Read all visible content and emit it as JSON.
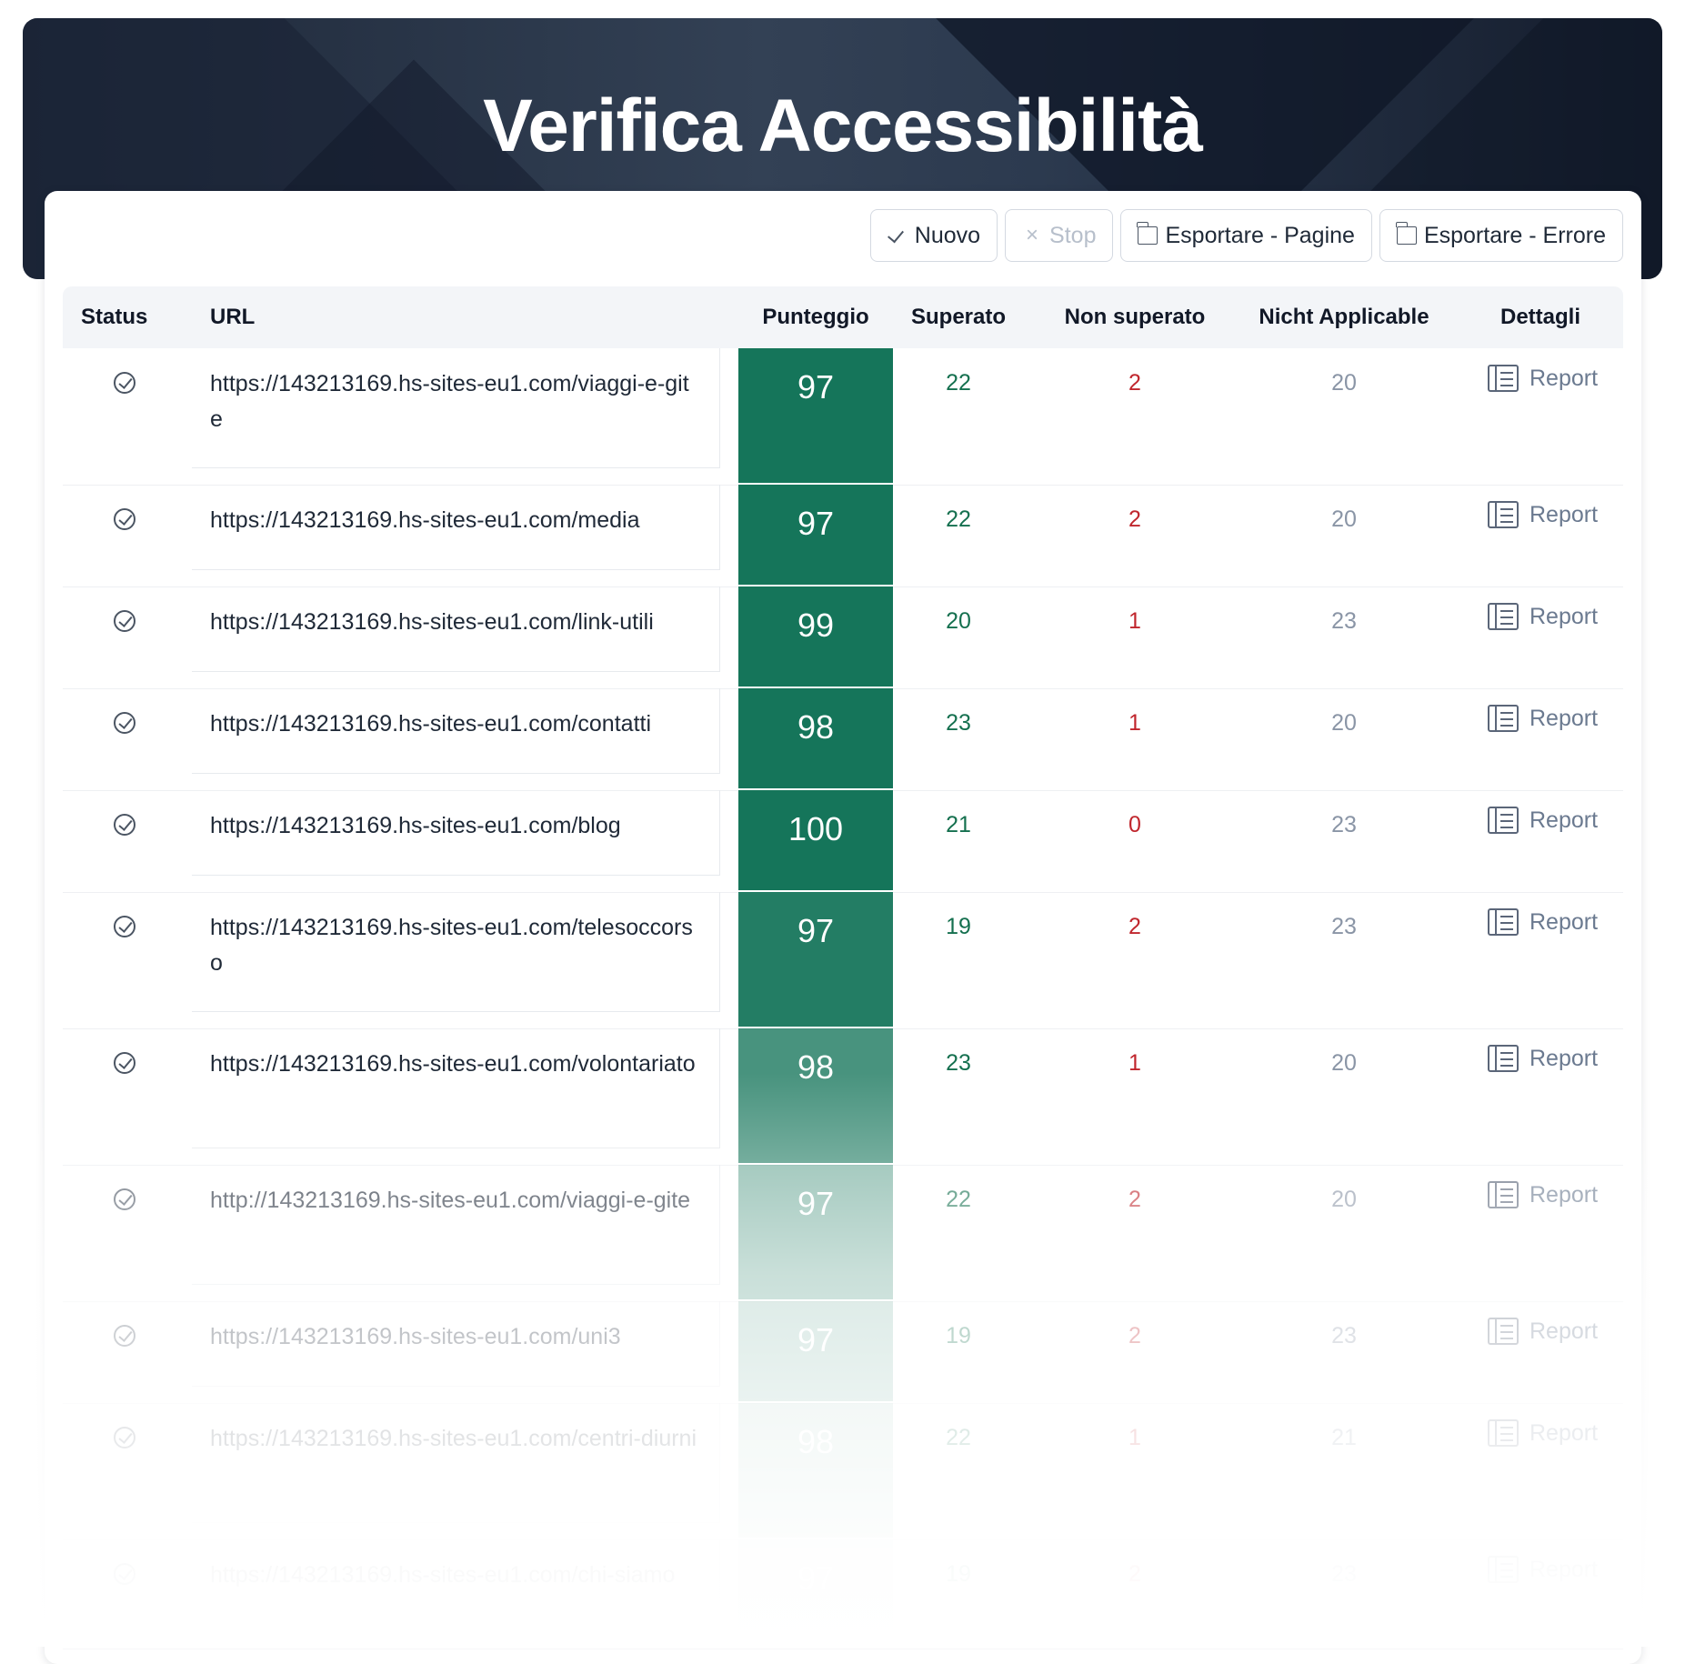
{
  "header": {
    "title": "Verifica Accessibilità"
  },
  "toolbar": {
    "new_label": "Nuovo",
    "stop_label": "Stop",
    "export_pages_label": "Esportare - Pagine",
    "export_errors_label": "Esportare - Errore"
  },
  "table": {
    "columns": {
      "status": "Status",
      "url": "URL",
      "score": "Punteggio",
      "passed": "Superato",
      "failed": "Non superato",
      "not_applicable": "Nicht Applicable",
      "details": "Dettagli"
    },
    "report_label": "Report",
    "rows": [
      {
        "url": "https://143213169.hs-sites-eu1.com/viaggi-e-gite",
        "score": "97",
        "passed": "22",
        "failed": "2",
        "na": "20"
      },
      {
        "url": "https://143213169.hs-sites-eu1.com/media",
        "score": "97",
        "passed": "22",
        "failed": "2",
        "na": "20"
      },
      {
        "url": "https://143213169.hs-sites-eu1.com/link-utili",
        "score": "99",
        "passed": "20",
        "failed": "1",
        "na": "23"
      },
      {
        "url": "https://143213169.hs-sites-eu1.com/contatti",
        "score": "98",
        "passed": "23",
        "failed": "1",
        "na": "20"
      },
      {
        "url": "https://143213169.hs-sites-eu1.com/blog",
        "score": "100",
        "passed": "21",
        "failed": "0",
        "na": "23"
      },
      {
        "url": "https://143213169.hs-sites-eu1.com/telesoccorso",
        "score": "97",
        "passed": "19",
        "failed": "2",
        "na": "23"
      },
      {
        "url": "https://143213169.hs-sites-eu1.com/volontariato",
        "score": "98",
        "passed": "23",
        "failed": "1",
        "na": "20"
      },
      {
        "url": "http://143213169.hs-sites-eu1.com/viaggi-e-gite",
        "score": "97",
        "passed": "22",
        "failed": "2",
        "na": "20"
      },
      {
        "url": "https://143213169.hs-sites-eu1.com/uni3",
        "score": "97",
        "passed": "19",
        "failed": "2",
        "na": "23"
      },
      {
        "url": "https://143213169.hs-sites-eu1.com/centri-diurni",
        "score": "98",
        "passed": "22",
        "failed": "1",
        "na": "21"
      },
      {
        "url": "https://143213169.hs-sites-eu1.com/chi-siamo",
        "score": "97",
        "passed": "19",
        "failed": "2",
        "na": "23"
      }
    ]
  },
  "colors": {
    "header_bg": "#334155",
    "score_bg": "#15755a",
    "passed": "#15704f",
    "failed": "#c0262d",
    "not_applicable": "#8a95a6"
  },
  "icons": {
    "status": "check-circle-icon",
    "new": "check-icon",
    "stop": "x-icon",
    "export": "folder-icon",
    "report": "report-list-icon"
  }
}
